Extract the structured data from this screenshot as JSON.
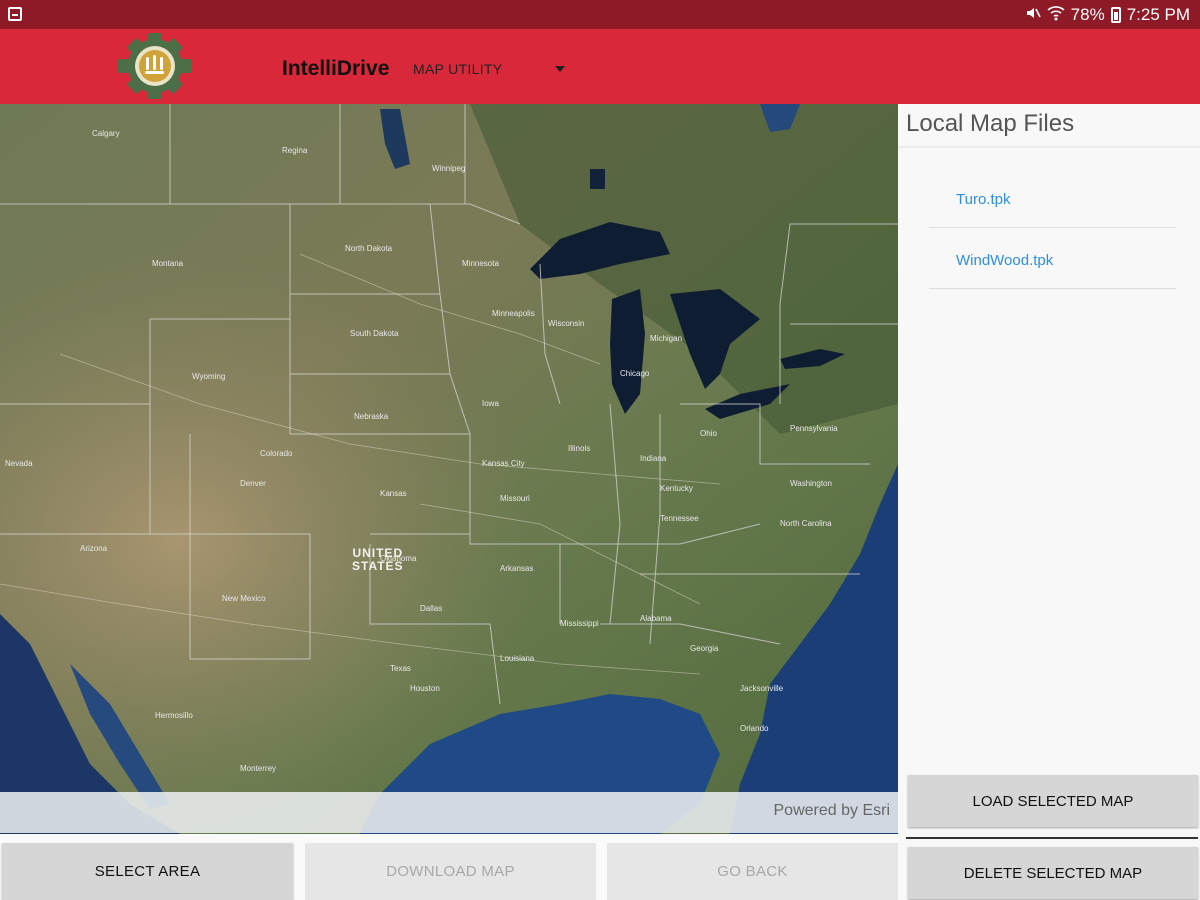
{
  "status_bar": {
    "battery": "78%",
    "time": "7:25 PM",
    "icons": [
      "notification-icon",
      "mute-icon",
      "wifi-icon",
      "battery-icon"
    ]
  },
  "app_bar": {
    "title": "IntelliDrive",
    "dropdown": {
      "selected": "MAP UTILITY"
    },
    "background_color": "#d9283a"
  },
  "map": {
    "country_label": "UNITED\nSTATES",
    "attribution": "Powered by Esri"
  },
  "map_buttons": {
    "select_area": "SELECT AREA",
    "download_map": "DOWNLOAD MAP",
    "go_back": "GO BACK"
  },
  "panel": {
    "title": "Local Map Files",
    "files": [
      {
        "label": "Turo.tpk"
      },
      {
        "label": "WindWood.tpk"
      }
    ],
    "load_button": "LOAD SELECTED MAP",
    "delete_button": "DELETE SELECTED MAP"
  },
  "colors": {
    "status_bar": "#8d1a26",
    "accent": "#d9283a",
    "link": "#2e8fe0"
  }
}
